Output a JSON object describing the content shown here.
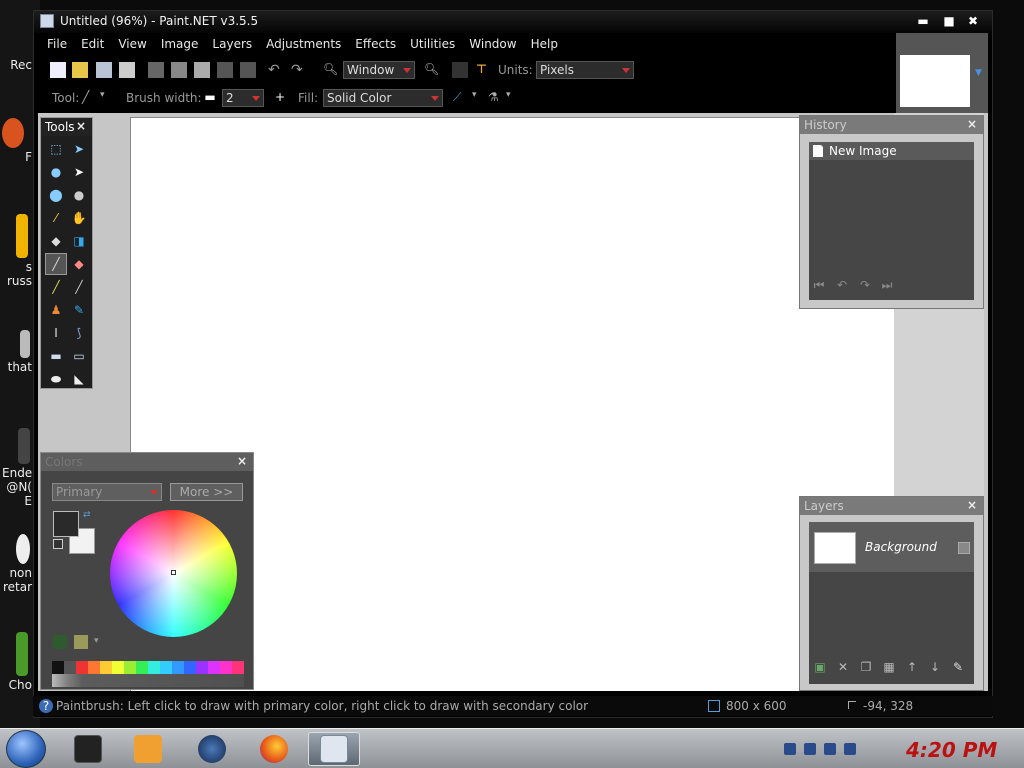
{
  "window": {
    "title": "Untitled (96%) - Paint.NET v3.5.5",
    "minimize": "▬",
    "maximize": "■",
    "close": "✖"
  },
  "menu": [
    "File",
    "Edit",
    "View",
    "Image",
    "Layers",
    "Adjustments",
    "Effects",
    "Utilities",
    "Window",
    "Help"
  ],
  "toolbar": {
    "zoom_value": "Window",
    "units_label": "Units:",
    "units_value": "Pixels",
    "tool_label": "Tool:",
    "brush_width_label": "Brush width:",
    "brush_width_value": "2",
    "fill_label": "Fill:",
    "fill_value": "Solid Color"
  },
  "panels": {
    "tools": {
      "title": "Tools",
      "close": "×"
    },
    "history": {
      "title": "History",
      "close": "×",
      "items": [
        "New Image"
      ]
    },
    "layers": {
      "title": "Layers",
      "close": "×",
      "items": [
        "Background"
      ]
    },
    "colors": {
      "title": "Colors",
      "close": "×",
      "mode": "Primary",
      "more_label": "More >>"
    }
  },
  "status": {
    "help_glyph": "?",
    "message": "Paintbrush: Left click to draw with primary color, right click to draw with secondary color",
    "image_size": "800 x 600",
    "cursor_position": "-94, 328"
  },
  "desktop_labels": [
    "Rec",
    "F",
    "s",
    "russ",
    "that",
    "Ende",
    "@N(",
    "E",
    "non",
    "retar",
    "Cho"
  ],
  "taskbar": {
    "clock": "4:20 PM"
  },
  "colors": {
    "accent_red": "#cc2222",
    "window_bg": "#000000",
    "canvas_bg": "#ffffff",
    "primary_color": "#2a2a2a",
    "secondary_color": "#f2f2f2"
  }
}
